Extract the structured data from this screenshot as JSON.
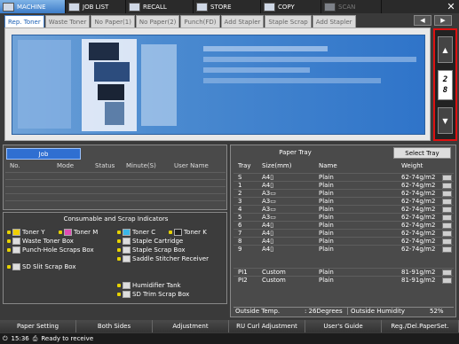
{
  "nav": {
    "items": [
      {
        "label": "MACHINE",
        "icon": "machine-icon"
      },
      {
        "label": "JOB LIST",
        "icon": "job-list-icon"
      },
      {
        "label": "RECALL",
        "icon": "recall-icon"
      },
      {
        "label": "STORE",
        "icon": "store-icon"
      },
      {
        "label": "COPY",
        "icon": "copy-icon"
      },
      {
        "label": "SCAN",
        "icon": "scan-icon"
      }
    ]
  },
  "tabs": [
    "Rep. Toner",
    "Waste Toner",
    "No Paper(1)",
    "No Paper(2)",
    "Punch(FD)",
    "Add Stapler",
    "Staple Scrap",
    "Add Stapler"
  ],
  "page_indicator": {
    "current": "2",
    "total": "8"
  },
  "job": {
    "tab_label": "Job",
    "columns": [
      "No.",
      "Mode",
      "Status",
      "Minute(S)",
      "User Name"
    ]
  },
  "consumables": {
    "title": "Consumable and Scrap Indicators",
    "items": {
      "toner_y": "Toner Y",
      "toner_m": "Toner M",
      "toner_c": "Toner C",
      "toner_k": "Toner K",
      "waste_toner": "Waste Toner Box",
      "punch_hole": "Punch-Hole Scraps Box",
      "staple_cartridge": "Staple Cartridge",
      "staple_scrap": "Staple Scrap Box",
      "saddle_stitcher": "Saddle Stitcher Receiver",
      "sd_slit": "SD Slit Scrap Box",
      "humidifier": "Humidifier Tank",
      "sd_trim": "SD Trim Scrap Box"
    }
  },
  "tray": {
    "title": "Paper Tray",
    "select_label": "Select Tray",
    "columns": [
      "Tray",
      "Size(mm)",
      "Name",
      "Weight"
    ],
    "rows": [
      {
        "tray": "S",
        "size": "A4▯",
        "name": "Plain",
        "weight": "62-74g/m2"
      },
      {
        "tray": "1",
        "size": "A4▯",
        "name": "Plain",
        "weight": "62-74g/m2"
      },
      {
        "tray": "2",
        "size": "A3▭",
        "name": "Plain",
        "weight": "62-74g/m2"
      },
      {
        "tray": "3",
        "size": "A3▭",
        "name": "Plain",
        "weight": "62-74g/m2"
      },
      {
        "tray": "4",
        "size": "A3▭",
        "name": "Plain",
        "weight": "62-74g/m2"
      },
      {
        "tray": "5",
        "size": "A3▭",
        "name": "Plain",
        "weight": "62-74g/m2"
      },
      {
        "tray": "6",
        "size": "A4▯",
        "name": "Plain",
        "weight": "62-74g/m2"
      },
      {
        "tray": "7",
        "size": "A4▯",
        "name": "Plain",
        "weight": "62-74g/m2"
      },
      {
        "tray": "8",
        "size": "A4▯",
        "name": "Plain",
        "weight": "62-74g/m2"
      },
      {
        "tray": "9",
        "size": "A4▯",
        "name": "Plain",
        "weight": "62-74g/m2"
      }
    ],
    "pi_rows": [
      {
        "tray": "PI1",
        "size": "Custom",
        "name": "Plain",
        "weight": "81-91g/m2"
      },
      {
        "tray": "PI2",
        "size": "Custom",
        "name": "Plain",
        "weight": "81-91g/m2"
      }
    ],
    "outside_temp_label": "Outside Temp.",
    "outside_temp_value": ": 26Degrees",
    "outside_humidity_label": "Outside Humidity",
    "outside_humidity_value": "52%"
  },
  "bottom": [
    "Paper Setting",
    "Both Sides",
    "Adjustment",
    "RU Curl Adjustment",
    "User's Guide",
    "Reg./Del.PaperSet."
  ],
  "status": {
    "time": "15:36",
    "message": "Ready to receive"
  },
  "colors": {
    "accent": "#2f6fd1",
    "highlight": "#dd1111"
  }
}
